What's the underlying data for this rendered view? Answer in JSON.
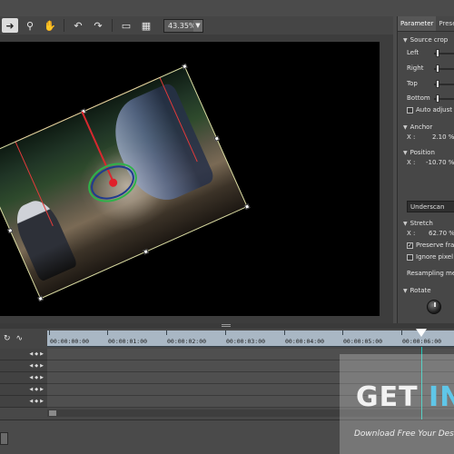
{
  "toolbar": {
    "zoom_value": "43.35%",
    "buttons": [
      "select-tool",
      "zoom-tool",
      "hand-tool",
      "undo",
      "redo",
      "fit-window",
      "safe-area"
    ]
  },
  "panel": {
    "tabs": [
      "Parameter",
      "Presets"
    ],
    "source_crop": {
      "title": "Source crop",
      "left": "Left",
      "right": "Right",
      "top": "Top",
      "bottom": "Bottom",
      "auto_adjust": "Auto adjust a"
    },
    "anchor": {
      "title": "Anchor",
      "x_label": "X :",
      "x_value": "2.10 %"
    },
    "position": {
      "title": "Position",
      "x_label": "X :",
      "x_value": "-10.70 %"
    },
    "mode_select": "Underscan",
    "stretch": {
      "title": "Stretch",
      "x_label": "X :",
      "x_value": "62.70 %",
      "preserve": "Preserve fram",
      "ignore": "Ignore pixel a"
    },
    "resampling": "Resampling meth",
    "rotate": {
      "title": "Rotate"
    }
  },
  "timeline": {
    "timecodes": [
      "00:00:00:00",
      "00:00:01:00",
      "00:00:02:00",
      "00:00:03:00",
      "00:00:04:00",
      "00:00:05:00",
      "00:00:06:00"
    ],
    "track_count": 5
  },
  "watermark": {
    "title_a": "GET ",
    "title_b": "IN",
    "subtitle": "Download Free Your Des"
  },
  "colors": {
    "anchor_green": "#2fb24a",
    "anchor_blue": "#1f3b8f",
    "anchor_red": "#e0202a",
    "playhead": "#22c7b8",
    "ruler": "#a9b7c4"
  }
}
